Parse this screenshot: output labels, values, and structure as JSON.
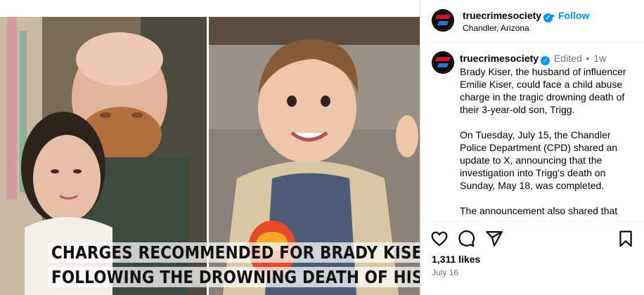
{
  "post": {
    "caption_line1": "CHARGES RECOMMENDED FOR BRADY KISER",
    "caption_line2": "FOLLOWING THE DROWNING DEATH OF HIS SON."
  },
  "header": {
    "username": "truecrimesociety",
    "verified_icon": "verified-badge-icon",
    "separator": "•",
    "follow_label": "Follow",
    "location": "Chandler, Arizona"
  },
  "comment": {
    "username": "truecrimesociety",
    "edited": "Edited",
    "separator": "•",
    "time": "1w",
    "paragraphs": [
      "Brady Kiser, the husband of influencer Emilie Kiser, could face a child abuse charge in the tragic drowning death of their 3-year-old son, Trigg.",
      "On Tuesday, July 15, the Chandler Police Department (CPD) shared an update to X, announcing that the investigation into Trigg's death on Sunday, May 18, was completed.",
      "The announcement also shared that"
    ]
  },
  "actions": {
    "icons": [
      "heart-icon",
      "comment-icon",
      "share-icon",
      "bookmark-icon"
    ],
    "likes": "1,311 likes",
    "date": "July 16"
  },
  "colors": {
    "accent": "#0095f6",
    "muted": "#737373"
  }
}
